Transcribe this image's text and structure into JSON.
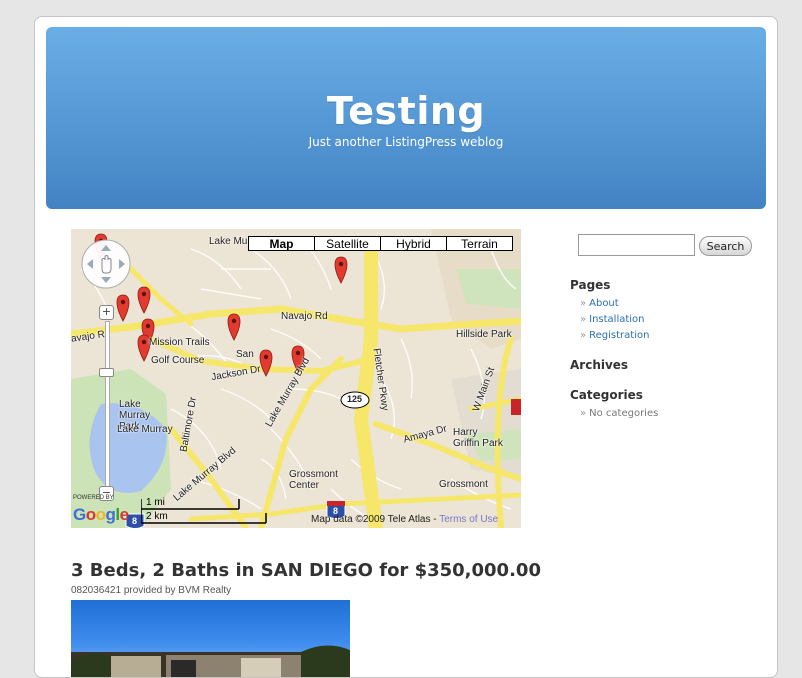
{
  "blog": {
    "title": "Testing",
    "description": "Just another ListingPress weblog"
  },
  "map": {
    "type_buttons": [
      "Map",
      "Satellite",
      "Hybrid",
      "Terrain"
    ],
    "active_type": "Map",
    "zoom_in": "+",
    "zoom_out": "−",
    "labels": {
      "lake_murray_top": "Lake Mur",
      "navajo_rd": "Navajo Rd",
      "hillside_park": "Hillside Park",
      "mission_trails": "Mission Trails",
      "golf_course": "Golf Course",
      "san": "San",
      "jackson_dr": "Jackson Dr",
      "lake_murray_park": "Lake Murray Park",
      "lake_murray": "Lake Murray",
      "navajo_left": "avajo Rd",
      "baltimore_dr": "Baltimore Dr",
      "lake_murray_blvd": "Lake Murray Blvd",
      "lake_murray_diag": "Lake Murray Blvd",
      "fletcher_pkwy": "Fletcher Pkwy",
      "w_main_st": "W Main St",
      "amaya_dr": "Amaya Dr",
      "harry_griffin_park": "Harry Griffin Park",
      "grossmont_center": "Grossmont Center",
      "grossmont": "Grossmont",
      "shield_125": "125",
      "shield_8": "8",
      "shield_8_left": "8"
    },
    "scale": {
      "imperial": "1 mi",
      "metric": "2 km"
    },
    "copyright": "Map data ©2009 Tele Atlas - ",
    "terms": "Terms of Use",
    "google_powered": "POWERED BY",
    "google_logo": "Google",
    "marker_color": "#e23a2f"
  },
  "listing": {
    "title": "3 Beds, 2 Baths in SAN DIEGO for $350,000.00",
    "meta": "082036421 provided by BVM Realty"
  },
  "sidebar": {
    "search_button": "Search",
    "search_value": "",
    "pages_title": "Pages",
    "pages": [
      "About",
      "Installation",
      "Registration"
    ],
    "archives_title": "Archives",
    "categories_title": "Categories",
    "categories_empty": "No categories",
    "bullet": "»"
  },
  "colors": {
    "header_top": "#6aaee6",
    "header_bottom": "#4383c4",
    "link": "#2a6fb5"
  }
}
